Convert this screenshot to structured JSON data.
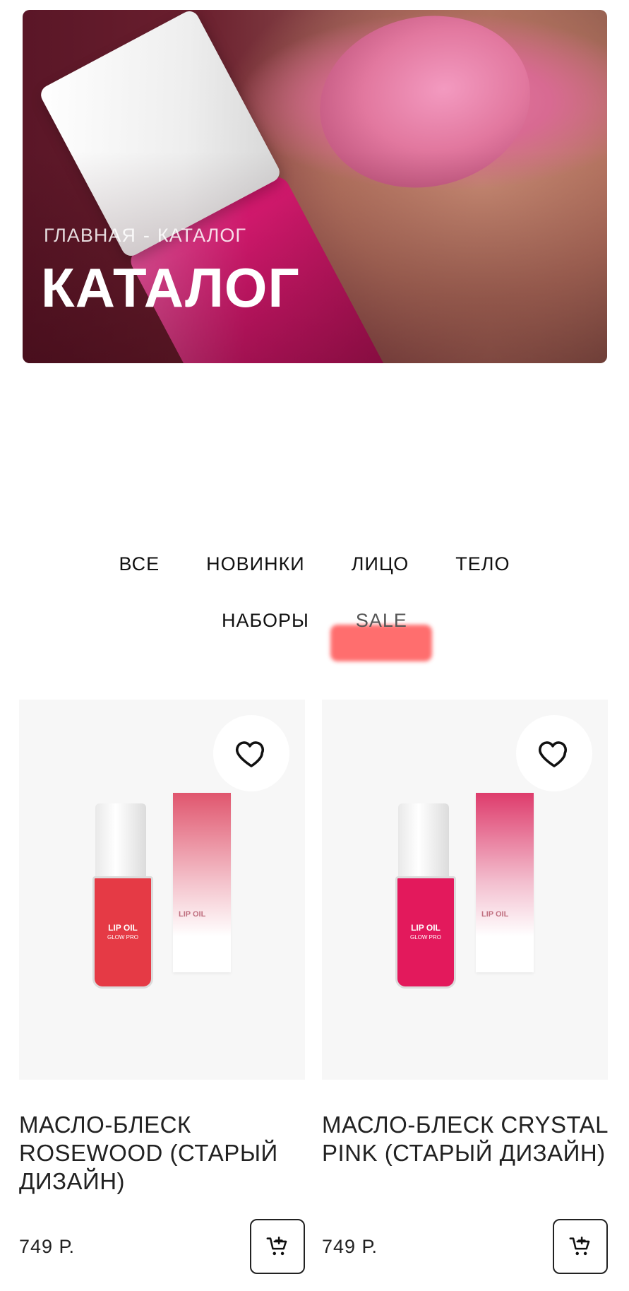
{
  "hero": {
    "breadcrumb_home": "ГЛАВНАЯ",
    "breadcrumb_sep": "-",
    "breadcrumb_current": "КАТАЛОГ",
    "title": "КАТАЛОГ"
  },
  "tabs": [
    {
      "label": "ВСЕ"
    },
    {
      "label": "НОВИНКИ"
    },
    {
      "label": "ЛИЦО"
    },
    {
      "label": "ТЕЛО"
    },
    {
      "label": "НАБОРЫ"
    },
    {
      "label": "SALE"
    }
  ],
  "products": [
    {
      "title": "МАСЛО-БЛЕСК ROSEWOOD (СТАРЫЙ ДИЗАЙН)",
      "price": "749 Р.",
      "bottle_text_1": "LIP OIL",
      "bottle_text_2": "GLOW PRO",
      "box_text": "LIP OIL",
      "liquid_color": "#e53a45",
      "box_gradient_top": "#e0566e"
    },
    {
      "title": "МАСЛО-БЛЕСК CRYSTAL PINK (СТАРЫЙ ДИЗАЙН)",
      "price": "749 Р.",
      "bottle_text_1": "LIP OIL",
      "bottle_text_2": "GLOW PRO",
      "box_text": "LIP OIL",
      "liquid_color": "#e3195c",
      "box_gradient_top": "#de3c6c"
    }
  ],
  "icons": {
    "favorite": "heart-icon",
    "cart": "add-to-cart-icon"
  },
  "colors": {
    "sale_badge": "#ff5f5f",
    "card_bg": "#f7f7f7"
  }
}
